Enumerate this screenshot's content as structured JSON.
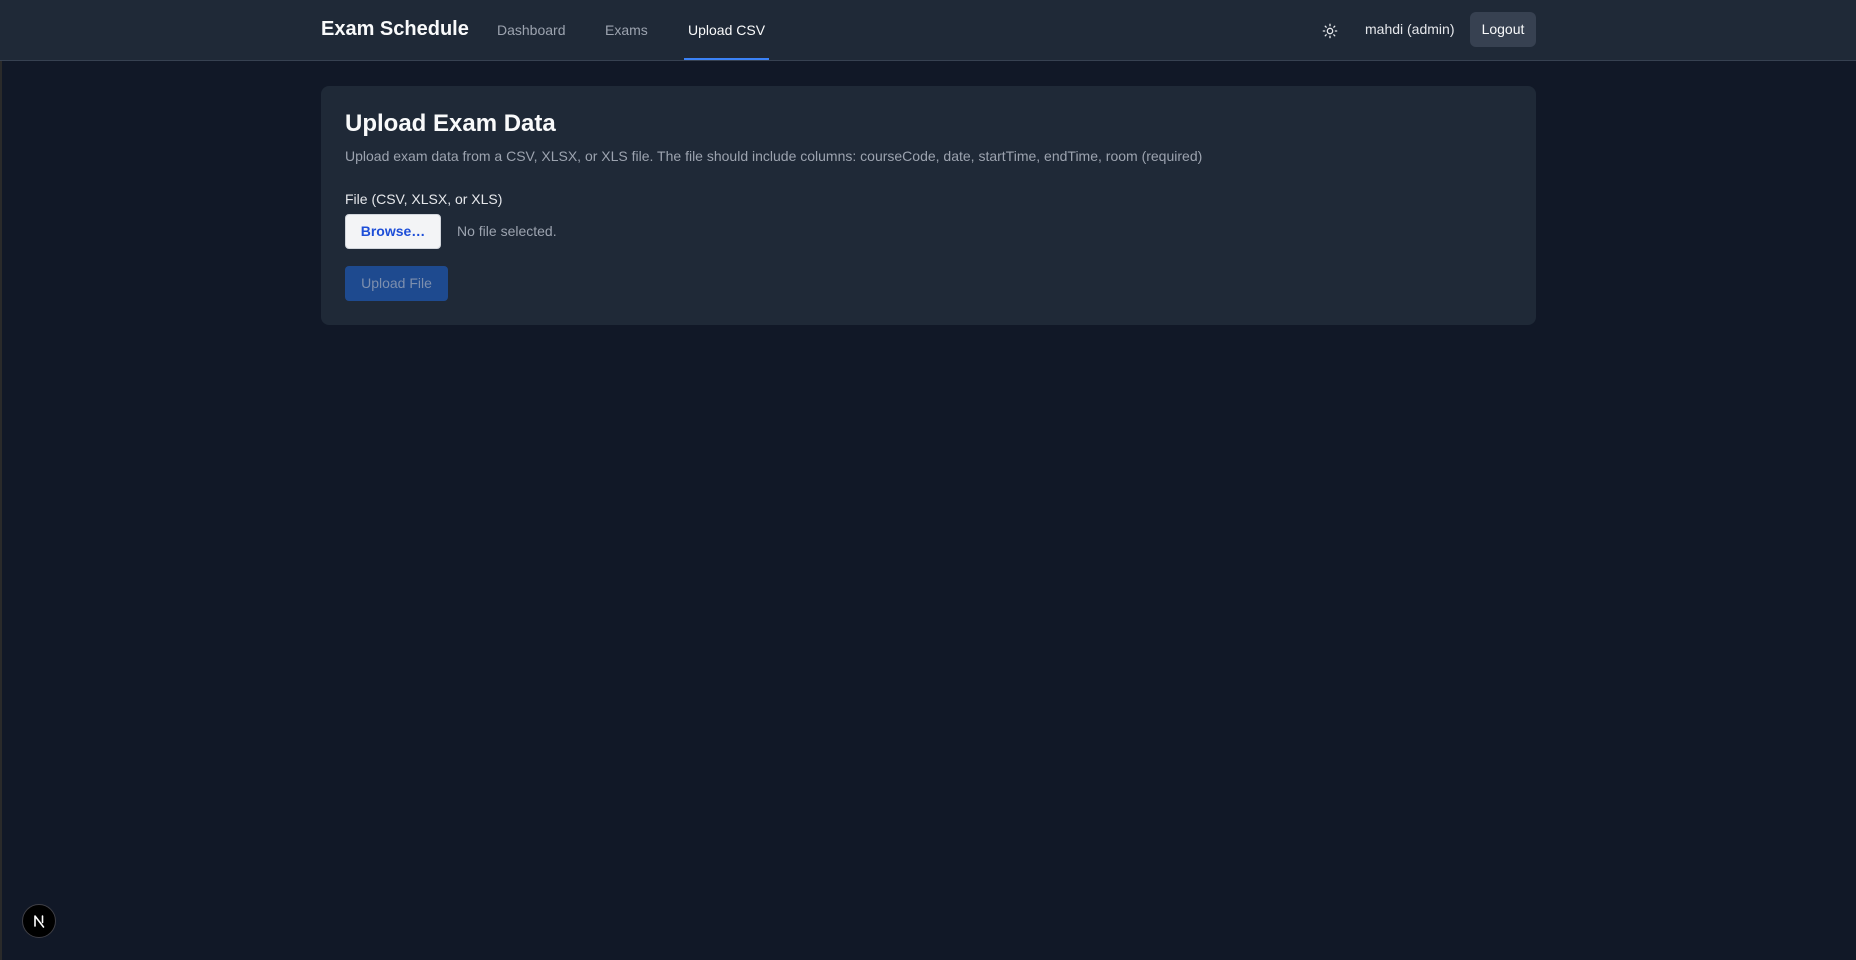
{
  "nav": {
    "brand": "Exam Schedule",
    "links": [
      {
        "label": "Dashboard"
      },
      {
        "label": "Exams"
      },
      {
        "label": "Upload CSV",
        "active": true
      }
    ],
    "theme_icon": "sun-icon",
    "user": "mahdi (admin)",
    "logout_label": "Logout"
  },
  "upload": {
    "title": "Upload Exam Data",
    "description": "Upload exam data from a CSV, XLSX, or XLS file. The file should include columns: courseCode, date, startTime, endTime, room (required)",
    "file_label": "File (CSV, XLSX, or XLS)",
    "browse_label": "Browse…",
    "file_status": "No file selected.",
    "submit_label": "Upload File",
    "submit_disabled": true
  },
  "badge": {
    "letter": "N",
    "icon": "nextjs-logo-icon"
  },
  "colors": {
    "background": "#111827",
    "surface": "#1f2937",
    "accent": "#3b82f6",
    "muted_text": "#9ca3af"
  }
}
